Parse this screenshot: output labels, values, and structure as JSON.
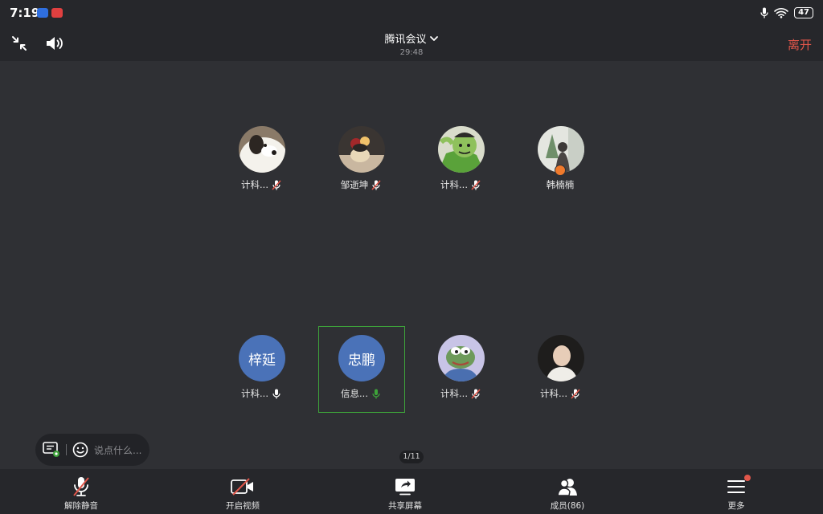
{
  "status_bar": {
    "time": "7:19",
    "battery": "47"
  },
  "top_bar": {
    "title": "腾讯会议",
    "duration": "29:48",
    "leave_label": "离开"
  },
  "participants": [
    {
      "name": "计科...",
      "mic": "muted"
    },
    {
      "name": "邹逝坤",
      "mic": "muted"
    },
    {
      "name": "计科...",
      "mic": "muted"
    },
    {
      "name": "韩楠楠",
      "mic": "none",
      "host": true
    },
    {
      "name": "计科...",
      "avatar_text": "梓延",
      "mic": "off"
    },
    {
      "name": "信息...",
      "avatar_text": "忠鹏",
      "mic": "speaking",
      "active": true
    },
    {
      "name": "计科...",
      "mic": "muted"
    },
    {
      "name": "计科...",
      "mic": "muted"
    }
  ],
  "chat": {
    "placeholder": "说点什么..."
  },
  "pagination": {
    "label": "1/11"
  },
  "toolbar": {
    "unmute_label": "解除静音",
    "video_label": "开启视频",
    "share_label": "共享屏幕",
    "members_label": "成员(86)",
    "more_label": "更多"
  },
  "colors": {
    "background": "#2f3034",
    "bar": "#26272b",
    "leave": "#e0564a",
    "speaking": "#3ea43a",
    "avatar": "#4a72b8"
  }
}
